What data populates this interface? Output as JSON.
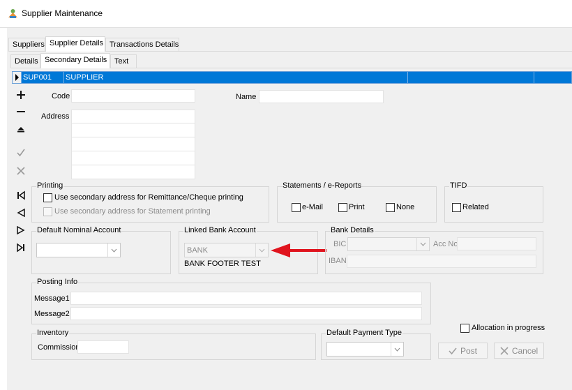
{
  "window": {
    "title": "Supplier Maintenance"
  },
  "tabs_main": [
    "Suppliers",
    "Supplier Details",
    "Transactions Details"
  ],
  "tabs_sub": [
    "Details",
    "Secondary Details",
    "Text"
  ],
  "grid_row": {
    "code": "SUP001",
    "name": "SUPPLIER"
  },
  "nav_icons": [
    "add-icon",
    "remove-icon",
    "collapse-icon",
    "confirm-icon",
    "cancel-icon",
    "first-record-icon",
    "previous-record-icon",
    "next-record-icon",
    "last-record-icon"
  ],
  "fields": {
    "code_label": "Code",
    "code_value": "",
    "name_label": "Name",
    "name_value": "",
    "address_label": "Address",
    "address_lines": [
      "",
      "",
      "",
      "",
      ""
    ]
  },
  "printing": {
    "legend": "Printing",
    "remittance_label": "Use secondary address for Remittance/Cheque printing",
    "statement_label": "Use secondary address for Statement printing"
  },
  "statements": {
    "legend": "Statements / e-Reports",
    "options": [
      "e-Mail",
      "Print",
      "None"
    ]
  },
  "tifd": {
    "legend": "TIFD",
    "related_label": "Related"
  },
  "default_nominal": {
    "legend": "Default Nominal Account",
    "value": ""
  },
  "linked_bank": {
    "legend": "Linked Bank Account",
    "value": "BANK",
    "footer": "BANK FOOTER TEST"
  },
  "bank_details": {
    "legend": "Bank Details",
    "bic_label": "BIC",
    "bic_value": "",
    "acc_label": "Acc No",
    "acc_value": "",
    "iban_label": "IBAN",
    "iban_value": ""
  },
  "posting": {
    "legend": "Posting Info",
    "message1_label": "Message1",
    "message1_value": "",
    "message2_label": "Message2",
    "message2_value": ""
  },
  "inventory": {
    "legend": "Inventory",
    "commission_label": "Commission",
    "commission_value": ""
  },
  "payment_type": {
    "legend": "Default Payment Type",
    "value": ""
  },
  "allocation_label": "Allocation in progress",
  "buttons": {
    "post": "Post",
    "cancel": "Cancel"
  },
  "colors": {
    "selection": "#0078d7",
    "arrow": "#e0141e"
  }
}
